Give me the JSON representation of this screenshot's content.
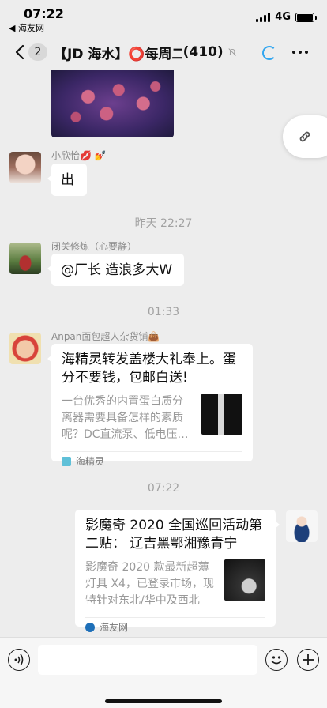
{
  "status_bar": {
    "time": "07:22",
    "back_app": "◀ 海友网",
    "network": "4G"
  },
  "nav": {
    "unread_count": "2",
    "title": "【JD 海水】⭕每周二…",
    "member_count": "(410)"
  },
  "messages": [
    {
      "sender": "小欣怡💋 💅",
      "text": "出"
    },
    {
      "sender": "闭关修炼（心要静）",
      "text": "@厂长 造浪多大W"
    }
  ],
  "dividers": [
    "昨天 22:27",
    "01:33",
    "07:22"
  ],
  "cards": [
    {
      "sender": "Anpan面包超人杂货铺👜",
      "title": "海精灵转发盖楼大礼奉上。蛋分不要钱，包邮白送!",
      "desc": "一台优秀的内置蛋白质分离器需要具备怎样的素质呢？DC直流泵、低电压…",
      "source": "海精灵"
    },
    {
      "title": "影魔奇 2020 全国巡回活动第二贴： 辽吉黑鄂湘豫青宁",
      "desc": "影魔奇 2020 款最新超薄灯具 X4，已登录市场，现特针对东北/华中及西北部…",
      "source": "海友网"
    }
  ],
  "colors": {
    "background": "#ededed",
    "bubble": "#ffffff",
    "accent": "#31a6f0"
  }
}
